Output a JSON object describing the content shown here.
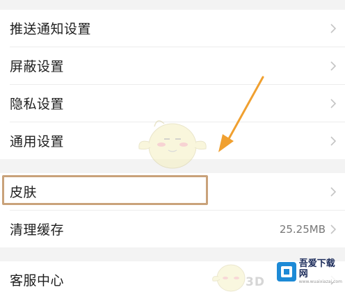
{
  "settings": {
    "group1": [
      {
        "label": "推送通知设置"
      },
      {
        "label": "屏蔽设置"
      },
      {
        "label": "隐私设置"
      },
      {
        "label": "通用设置"
      }
    ],
    "group2": [
      {
        "label": "皮肤"
      },
      {
        "label": "清理缓存",
        "value": "25.25MB"
      }
    ],
    "group3": [
      {
        "label": "客服中心"
      }
    ]
  },
  "annotation": {
    "highlight_color": "#c9a27a",
    "arrow_color": "#f0a030"
  },
  "watermark": {
    "site_name": "吾爱下载网",
    "mark_3d": "3D",
    "url": "www.wuaixiazai.com"
  },
  "icons": {
    "row_chevron": "chevron-right-icon"
  }
}
